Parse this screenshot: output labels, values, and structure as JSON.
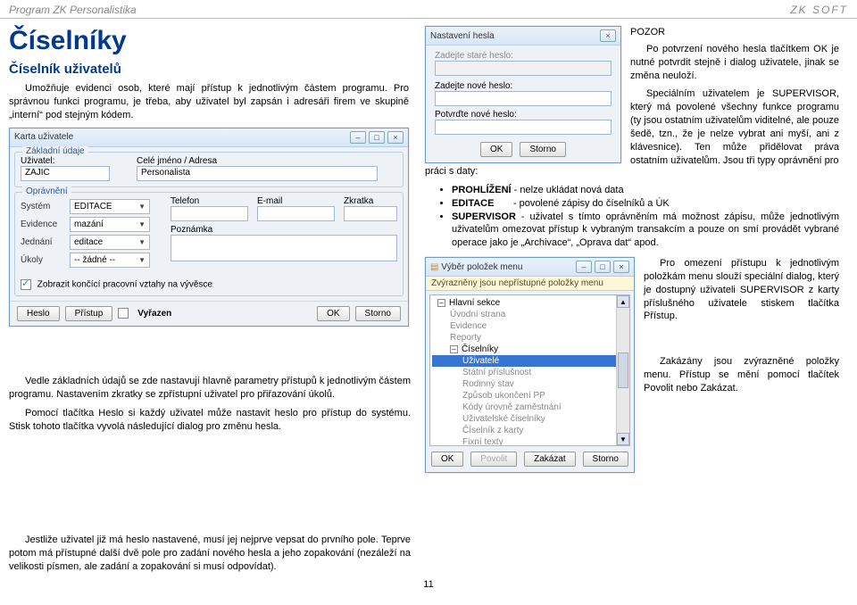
{
  "header": {
    "program": "Program ZK Personalistika",
    "brand": "ZK SOFT"
  },
  "h1": "Číselníky",
  "h2": "Číselník uživatelů",
  "intro1": "Umožňuje evidenci osob, které mají přístup k jednotlivým částem programu. Pro správnou funkci programu, je třeba, aby uživatel byl zapsán i adresáři firem ve skupině „interní“ pod stejným kódem.",
  "password_dialog": {
    "title": "Nastavení hesla",
    "old_label": "Zadejte staré heslo:",
    "new_label": "Zadejte nové heslo:",
    "confirm_label": "Potvrďte nové heslo:",
    "ok": "OK",
    "cancel": "Storno"
  },
  "card": {
    "title": "Karta uživatele",
    "group_basic": "Základní údaje",
    "user_label": "Uživatel:",
    "user_value": "ZAJIC",
    "name_label": "Celé jméno / Adresa",
    "name_value": "Personalista",
    "group_perm": "Oprávnění",
    "system_label": "Systém",
    "system_value": "EDITACE",
    "evid_label": "Evidence",
    "evid_value": "mazání",
    "jedn_label": "Jednání",
    "jedn_value": "editace",
    "ukoly_label": "Úkoly",
    "ukoly_value": "-- žádné --",
    "tel_label": "Telefon",
    "email_label": "E-mail",
    "zkratka_label": "Zkratka",
    "note_label": "Poznámka",
    "chk_label": "Zobrazit končící pracovní vztahy na vývěsce",
    "btn_heslo": "Heslo",
    "btn_pristup": "Přístup",
    "btn_vyrazen": "Vyřazen",
    "btn_ok": "OK",
    "btn_cancel": "Storno"
  },
  "pozor_title": "POZOR",
  "pozor_p1": "Po potvrzení nového hesla tlačítkem OK je nutné potvrdit stejně i dialog uživatele, jinak se změna neuloží.",
  "pozor_p2a": "Speciálním uživatelem je SUPERVISOR, který má povolené všechny funkce programu (ty jsou ostatním uživatelům viditelné, ale pouze šedě, tzn., že je nelze vybrat ani myší, ani z klávesnice). Ten může přidělovat práva ostatním uživatelům. Jsou tři typy oprávnění pro ",
  "pozor_p2_tail": "práci s daty:",
  "bullets": {
    "b1a": "PROHLÍŽENÍ",
    "b1b": " - nelze ukládat nová data",
    "b2a": "EDITACE",
    "b2b": "       - povolené zápisy do číselníků a ÚK",
    "b3a": "SUPERVISOR",
    "b3b": " - uživatel s tímto oprávněním má možnost zápisu, může jednotlivým uživatelům omezovat přístup k vybraným transakcím a pouze on smí provádět vybrané operace jako je „Archivace“, „Oprava dat“ apod."
  },
  "menu_dialog": {
    "title": "Výběr položek menu",
    "strip": "Zvýrazněny jsou nepřístupné položky menu",
    "root": "Hlavní sekce",
    "items": [
      "Úvodní strana",
      "Evidence",
      "Reporty",
      "Číselníky",
      "Uživatelé",
      "Státní příslušnost",
      "Rodinný stav",
      "Způsob ukončení PP",
      "Kódy úrovně zaměstnání",
      "Uživatelské číselníky",
      "Číselník z karty",
      "Fixní texty"
    ],
    "btn_ok": "OK",
    "btn_povolit": "Povolit",
    "btn_zakazat": "Zakázat",
    "btn_storno": "Storno"
  },
  "right_para1": "Pro omezení přístupu k jednotlivým položkám menu slouží speciální dialog, který je dostupný uživateli SUPERVISOR z karty příslušného uživatele stiskem tlačítka Přístup.",
  "right_para2": "Zakázány jsou zvýrazněné položky menu. Přístup se mění pomocí tlačítek Povolit nebo Zakázat.",
  "left_para1": "Vedle základních údajů se zde nastavují hlavně parametry přístupů k jednotlivým částem programu. Nastavením zkratky se zpřístupní uživatel pro přiřazování úkolů.",
  "left_para2": "Pomocí tlačítka Heslo si každý uživatel může nastavit heslo pro přístup do systému. Stisk tohoto tlačítka vyvolá následující dialog pro změnu hesla.",
  "bottom_para": "Jestliže uživatel již má heslo nastavené, musí jej nejprve vepsat do prvního pole. Teprve potom má přístupné další dvě pole pro zadání nového hesla a jeho zopakování (nezáleží na velikosti písmen, ale zadání a zopakování si musí odpovídat).",
  "page_num": "11"
}
